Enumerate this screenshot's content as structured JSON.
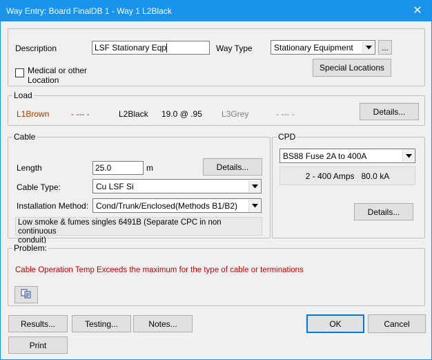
{
  "window": {
    "title": "Way Entry: Board FinalDB 1 - Way 1 L2Black",
    "close_glyph": "✕"
  },
  "general": {
    "description_label": "Description",
    "description_value": "LSF Stationary Eqp",
    "way_type_label": "Way Type",
    "way_type_value": "Stationary Equipment",
    "browse_label": "...",
    "medical_label_line1": "Medical or other",
    "medical_label_line2": "Location",
    "special_locations_label": "Special Locations"
  },
  "load": {
    "legend": "Load",
    "l1_label": "L1Brown",
    "l1_value": "- --- -",
    "l2_label": "L2Black",
    "l2_value": "19.0 @ .95",
    "l3_label": "L3Grey",
    "l3_value": "- --- -",
    "details_label": "Details...",
    "details_color": "#a03a00",
    "grey_color": "#808080"
  },
  "cable": {
    "legend": "Cable",
    "length_label": "Length",
    "length_value": "25.0",
    "length_unit": "m",
    "details_label": "Details...",
    "cable_type_label": "Cable Type:",
    "cable_type_value": "Cu LSF  Si",
    "installation_label": "Installation Method:",
    "installation_value": "Cond/Trunk/Enclosed(Methods B1/B2)",
    "description_line1": "Low smoke & fumes singles 6491B (Separate CPC in non continuous",
    "description_line2": "conduit)"
  },
  "cpd": {
    "legend": "CPD",
    "device_value": "BS88 Fuse 2A to 400A",
    "rating_text": "2 - 400 Amps   80.0 kA",
    "details_label": "Details..."
  },
  "problem": {
    "legend": "Problem:",
    "message": "Cable Operation Temp Exceeds the maximum for the type of cable or terminations",
    "message_color": "#c00000",
    "copy_icon": "copy-icon"
  },
  "footer": {
    "results_label": "Results...",
    "testing_label": "Testing...",
    "notes_label": "Notes...",
    "ok_label": "OK",
    "cancel_label": "Cancel",
    "print_label": "Print"
  },
  "colors": {
    "titlebar": "#1a93ec",
    "dialog_bg": "#f0f0f0",
    "default_button_border": "#0078d7"
  }
}
